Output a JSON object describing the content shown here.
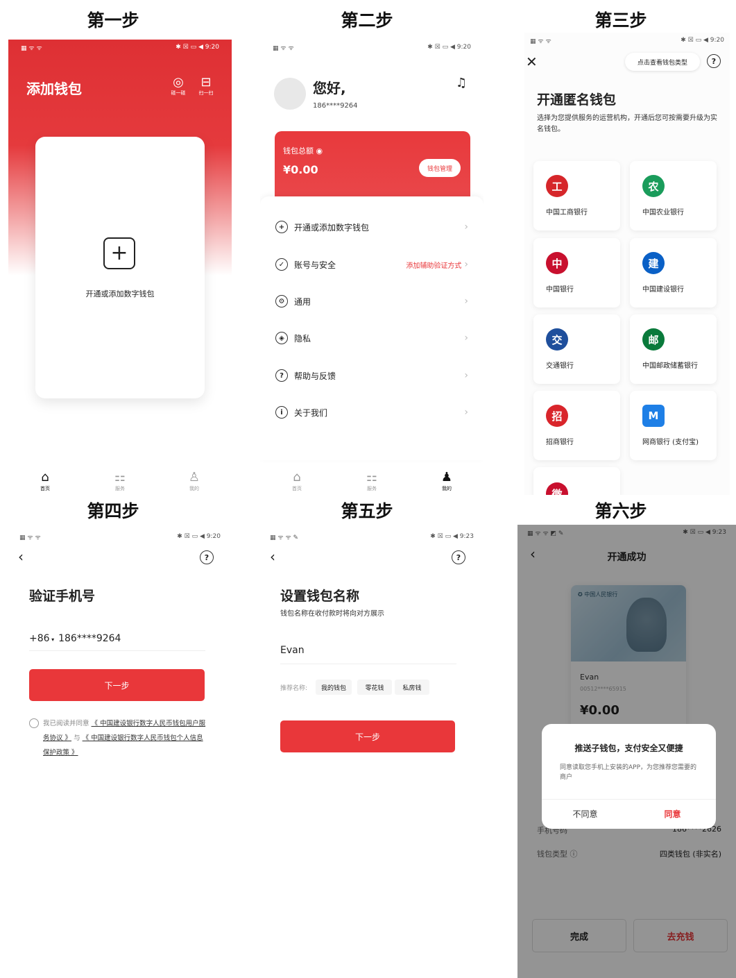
{
  "captions": [
    "第一步",
    "第二步",
    "第三步",
    "第四步",
    "第五步",
    "第六步"
  ],
  "status": {
    "time_a": "9:20",
    "time_b": "9:23",
    "icons": "✱ ☒ ▭ ◀"
  },
  "step1": {
    "title": "添加钱包",
    "icon1_label": "碰一碰",
    "icon2_label": "扫一扫",
    "card_label": "开通或添加数字钱包",
    "tabs": [
      "首页",
      "服务",
      "我的"
    ]
  },
  "step2": {
    "greeting": "您好,",
    "phone": "186****9264",
    "balance_label": "钱包总额",
    "balance": "¥0.00",
    "manage_button": "钱包管理",
    "menu": [
      {
        "label": "开通或添加数字钱包",
        "extra": ""
      },
      {
        "label": "账号与安全",
        "extra": "添加辅助验证方式"
      },
      {
        "label": "通用",
        "extra": ""
      },
      {
        "label": "隐私",
        "extra": ""
      },
      {
        "label": "帮助与反馈",
        "extra": ""
      },
      {
        "label": "关于我们",
        "extra": ""
      }
    ],
    "tabs": [
      "首页",
      "服务",
      "我的"
    ]
  },
  "step3": {
    "type_button": "点击查看钱包类型",
    "title": "开通匿名钱包",
    "desc": "选择为您提供服务的运营机构，开通后您可按需要升级为实名钱包。",
    "banks": [
      "中国工商银行",
      "中国农业银行",
      "中国银行",
      "中国建设银行",
      "交通银行",
      "中国邮政储蓄银行",
      "招商银行",
      "网商银行 (支付宝)"
    ],
    "colors": {
      "icbc": "#d6262a",
      "abc": "#1a9c5b",
      "boc": "#c8102e",
      "ccb": "#0a60c6",
      "bocom": "#1f4f9c",
      "psbc": "#0a7a3b",
      "cmb": "#d9252b",
      "mybank": "#1e7fe6"
    }
  },
  "step4": {
    "title": "验证手机号",
    "country_code": "+86",
    "phone": "186****9264",
    "next_button": "下一步",
    "agree_prefix": "我已阅读并同意",
    "agreement1": "《 中国建设银行数字人民币钱包用户服务协议 》",
    "agree_and": "与",
    "agreement2": "《 中国建设银行数字人民币钱包个人信息保护政策 》"
  },
  "step5": {
    "title": "设置钱包名称",
    "desc": "钱包名称在收付款时将向对方展示",
    "name_value": "Evan",
    "suggest_label": "推荐名称:",
    "suggestions": [
      "我的钱包",
      "零花钱",
      "私房钱"
    ],
    "next_button": "下一步"
  },
  "step6": {
    "title": "开通成功",
    "bank_text": "中国人民银行",
    "wallet_name": "Evan",
    "wallet_id": "00512****65915",
    "balance": "¥0.00",
    "modal_title": "推送子钱包，支付安全又便捷",
    "modal_desc": "同意读取您手机上安装的APP，为您推荐您需要的商户",
    "disagree": "不同意",
    "agree": "同意",
    "row_phone_label": "手机号码",
    "row_phone_value": "186****2626",
    "row_type_label": "钱包类型",
    "row_type_value": "四类钱包 (非实名)",
    "done_button": "完成",
    "topup_button": "去充钱"
  }
}
